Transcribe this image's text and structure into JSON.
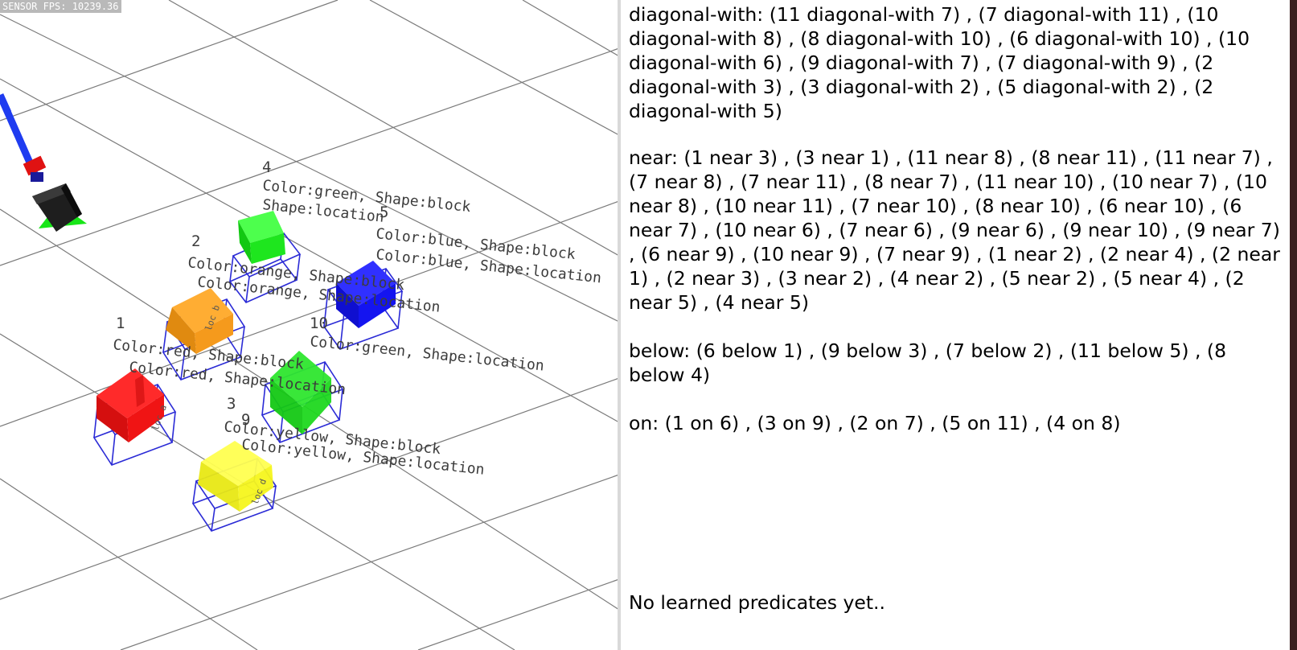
{
  "viewport": {
    "fps_text": "SENSOR FPS: 10239.36"
  },
  "objects": [
    {
      "id": "4",
      "block_label": "Color:green, Shape:block",
      "loc_label": "Shape:location",
      "color": "#19e619"
    },
    {
      "id": "5",
      "block_label": "Color:blue, Shape:block",
      "loc_label": "Color:blue, Shape:location",
      "color": "#1414f0"
    },
    {
      "id": "2",
      "block_label": "Color:orange, Shape:block",
      "loc_label": "Color:orange, Shape:location",
      "color": "#f59a1c"
    },
    {
      "id": "10",
      "block_label": "Color:green, Shape:location"
    },
    {
      "id": "1",
      "block_label": "Color:red, Shape:block",
      "loc_label": "Color:red, Shape:location",
      "color": "#f01414",
      "loc_tag": "loc a"
    },
    {
      "id": "3",
      "block_label": "Color:yellow, Shape:block",
      "loc_label": "Color:yellow, Shape:location",
      "color": "#f5f51c",
      "loc_tag": "loc d"
    },
    {
      "id": "9"
    }
  ],
  "orange_loc_tag": "loc b",
  "predicates": [
    {
      "name": "diagonal-with",
      "text": "diagonal-with: (11 diagonal-with 7) , (7 diagonal-with 11) , (10 diagonal-with 8) , (8 diagonal-with 10) , (6 diagonal-with 10) , (10 diagonal-with 6) , (9 diagonal-with 7) , (7 diagonal-with 9) , (2 diagonal-with 3) , (3 diagonal-with 2) , (5 diagonal-with 2) , (2 diagonal-with 5)"
    },
    {
      "name": "near",
      "text": "near: (1 near 3) , (3 near 1) , (11 near 8) , (8 near 11) , (11 near 7) , (7 near 8) , (7 near 11) , (8 near 7) , (11 near 10) , (10 near 7) , (10 near 8) , (10 near 11) , (7 near 10) , (8 near 10) , (6 near 10) , (6 near 7) , (10 near 6) , (7 near 6) , (9 near 6) , (9 near 10) , (9 near 7) , (6 near 9) , (10 near 9) , (7 near 9) , (1 near 2) , (2 near 4) , (2 near 1) , (2 near 3) , (3 near 2) , (4 near 2) , (5 near 2) , (5 near 4) , (2 near 5) , (4 near 5)"
    },
    {
      "name": "below",
      "text": "below: (6 below 1) , (9 below 3) , (7 below 2) , (11 below 5) , (8 below 4)"
    },
    {
      "name": "on",
      "text": "on: (1 on 6) , (3 on 9) , (2 on 7) , (5 on 11) , (4 on 8)"
    }
  ],
  "learned_text": "No learned predicates yet.."
}
